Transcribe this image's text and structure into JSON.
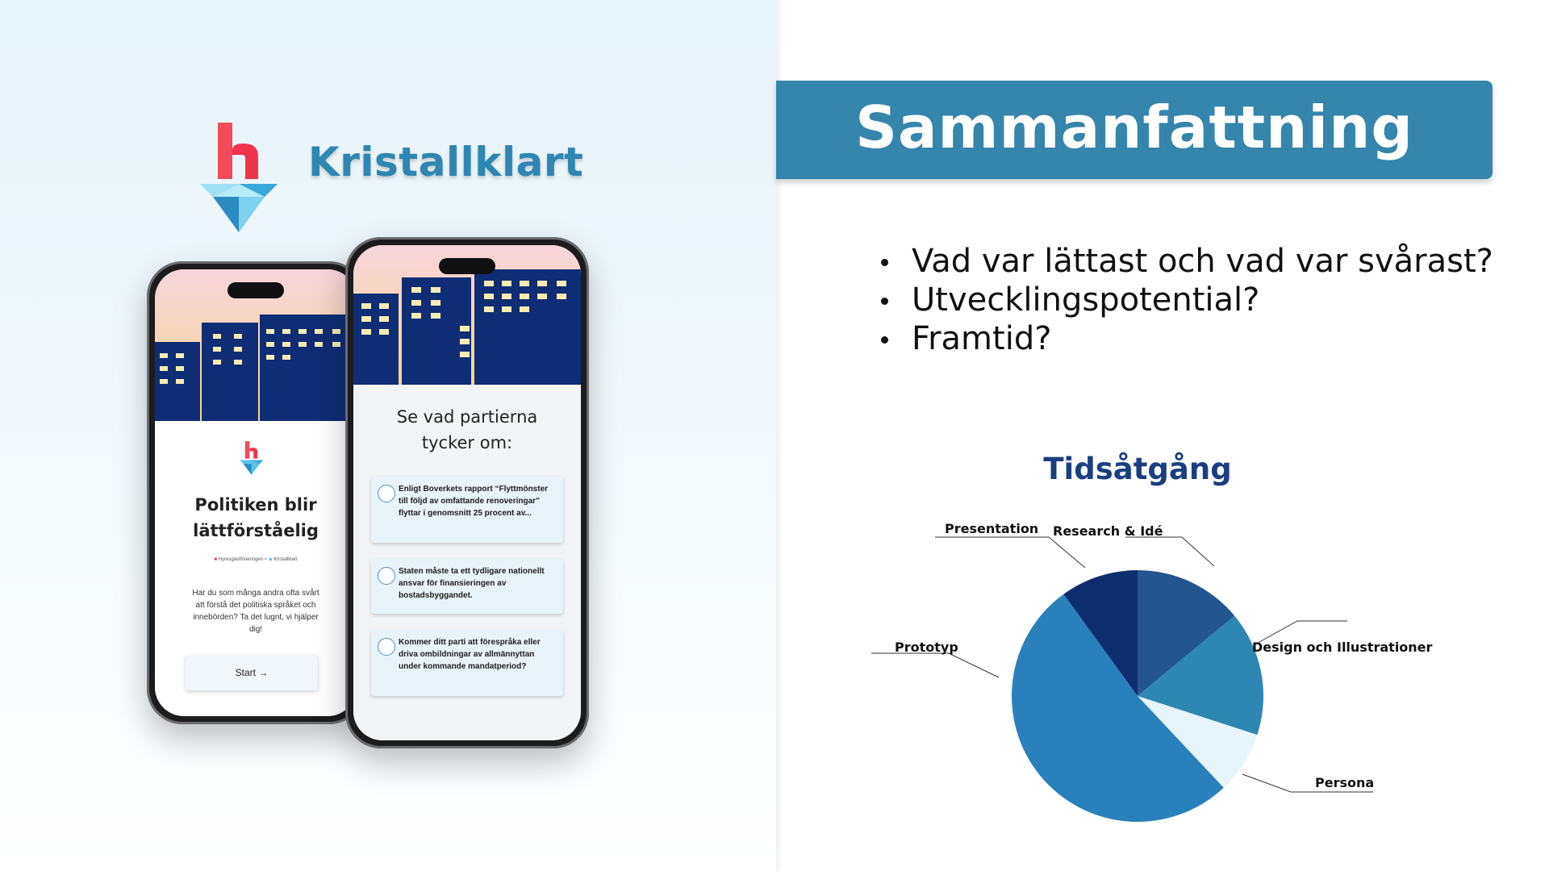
{
  "brand": {
    "name": "Kristallklart",
    "colors": {
      "red": "#f0344a",
      "blue": "#2e86b3"
    }
  },
  "phone_left": {
    "title": "Politiken blir lättförståelig",
    "partner_left": "Hyresgästföreningen",
    "partner_sep": "×",
    "partner_right": "Kristallklart",
    "description": "Har du som många andra ofta svårt att förstå det politiska språket och innebörden? Ta det lugnt, vi hjälper dig!",
    "start_label": "Start →"
  },
  "phone_right": {
    "title": "Se vad partierna tycker om:",
    "cards": [
      "Enligt Boverkets rapport “Flyttmönster till följd av omfattande renoveringar” flyttar i genomsnitt 25 procent av...",
      "Staten måste ta ett tydligare nationellt ansvar för finansieringen av bostadsbyggandet.",
      "Kommer ditt parti att förespråka eller driva ombildningar av allmännyttan under kommande mandatperiod?"
    ]
  },
  "slide": {
    "title": "Sammanfattning",
    "bullets": [
      "Vad var lättast och vad var svårast?",
      "Utvecklingspotential?",
      "Framtid?"
    ]
  },
  "chart_data": {
    "type": "pie",
    "title": "Tidsåtgång",
    "slices": [
      {
        "label": "Research & Idé",
        "value": 14,
        "color": "#23558f"
      },
      {
        "label": "Design och Illustrationer",
        "value": 16,
        "color": "#2e87b3"
      },
      {
        "label": "Persona",
        "value": 8,
        "color": "#e6f4fb"
      },
      {
        "label": "Prototyp",
        "value": 52,
        "color": "#2a80ba"
      },
      {
        "label": "Presentation",
        "value": 10,
        "color": "#0d2e6e"
      }
    ],
    "legend": "callout-labels"
  }
}
